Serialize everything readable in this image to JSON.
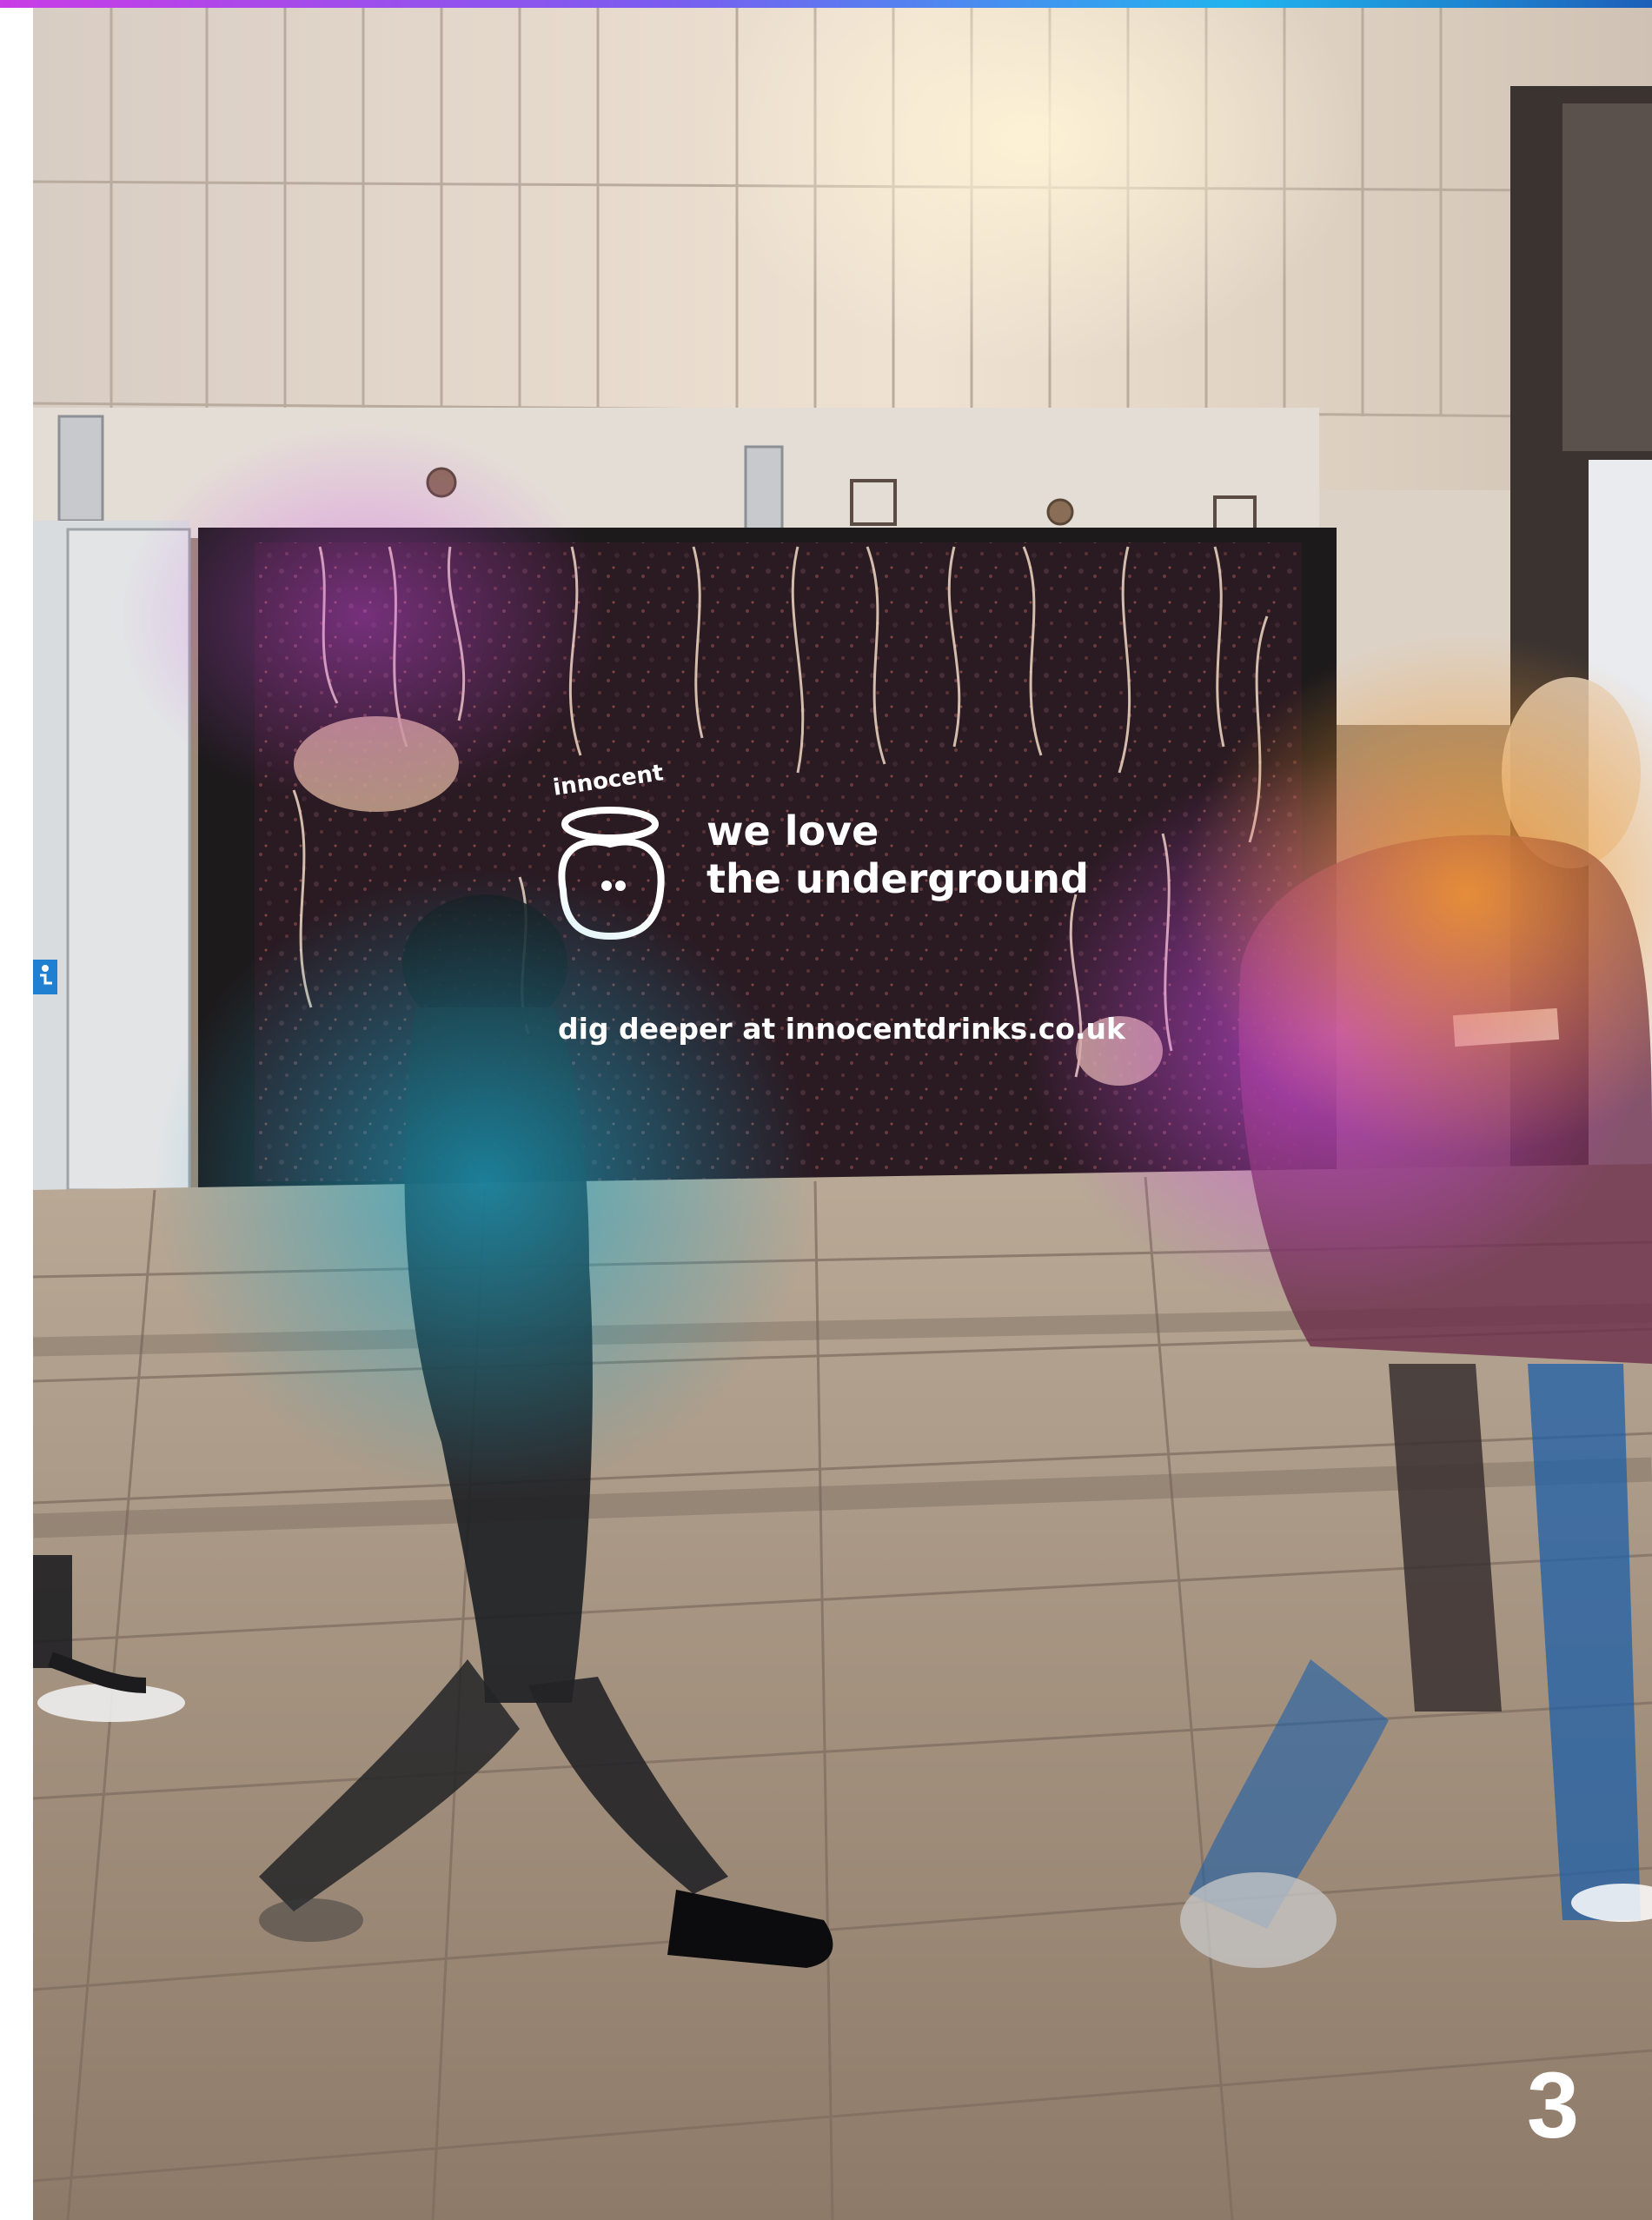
{
  "billboard": {
    "brand": "innocent",
    "headline_line1": "we love",
    "headline_line2": "the underground",
    "cta": "dig deeper at innocentdrinks.co.uk"
  },
  "page_number": "3",
  "icons": {
    "accessibility": "wheelchair-icon",
    "logo": "innocent-logo-icon"
  },
  "colors": {
    "accent_purple": "#c93ce6",
    "accent_blue": "#20b4ef",
    "accent_orange": "#f2922a",
    "accessibility_blue": "#1f7fd1"
  }
}
